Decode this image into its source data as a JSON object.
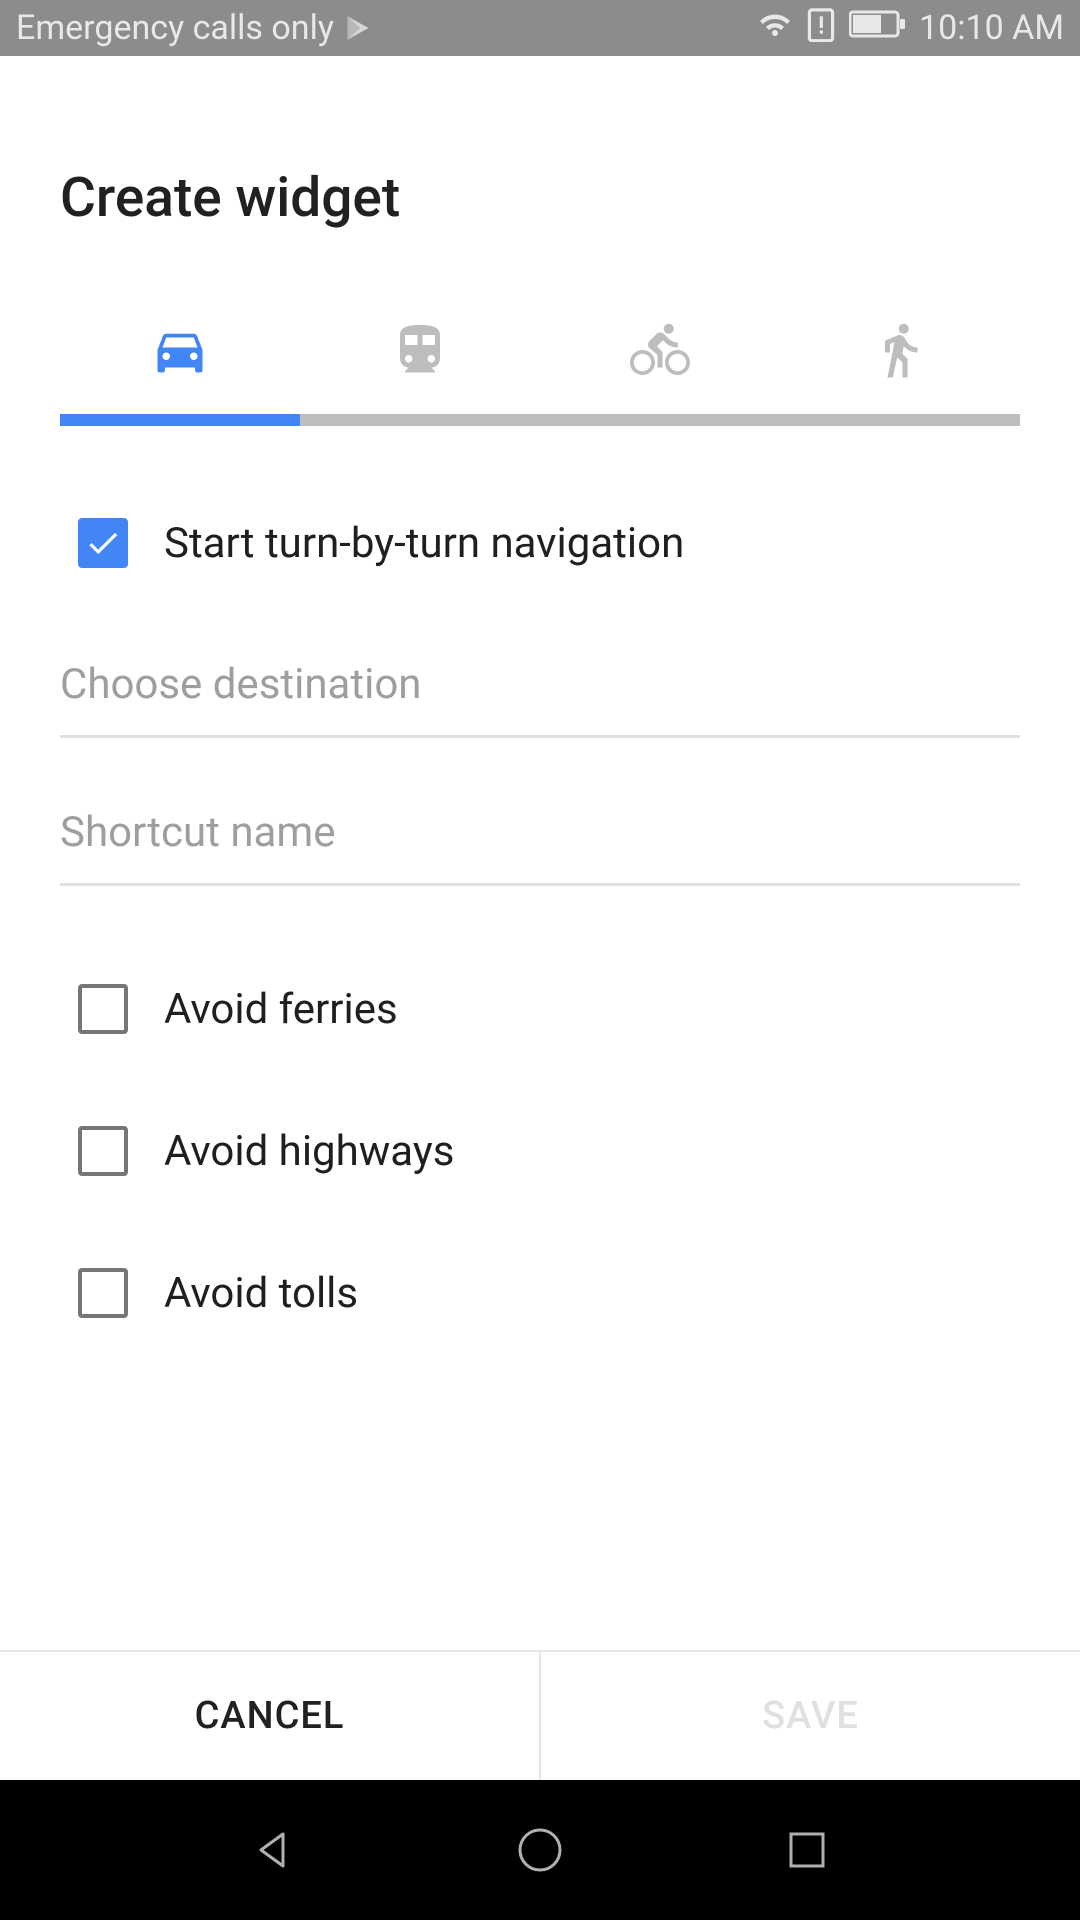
{
  "status_bar": {
    "carrier_text": "Emergency calls only",
    "time": "10:10 AM"
  },
  "page": {
    "title": "Create widget"
  },
  "tabs": {
    "items": [
      {
        "icon": "car",
        "active": true
      },
      {
        "icon": "transit",
        "active": false
      },
      {
        "icon": "bicycle",
        "active": false
      },
      {
        "icon": "walk",
        "active": false
      }
    ]
  },
  "form": {
    "start_navigation_label": "Start turn-by-turn navigation",
    "start_navigation_checked": true,
    "destination_placeholder": "Choose destination",
    "shortcut_placeholder": "Shortcut name",
    "avoid_ferries_label": "Avoid ferries",
    "avoid_ferries_checked": false,
    "avoid_highways_label": "Avoid highways",
    "avoid_highways_checked": false,
    "avoid_tolls_label": "Avoid tolls",
    "avoid_tolls_checked": false
  },
  "buttons": {
    "cancel": "CANCEL",
    "save": "SAVE"
  },
  "colors": {
    "accent": "#4285f4",
    "inactive_tab": "#bdbdbd"
  }
}
